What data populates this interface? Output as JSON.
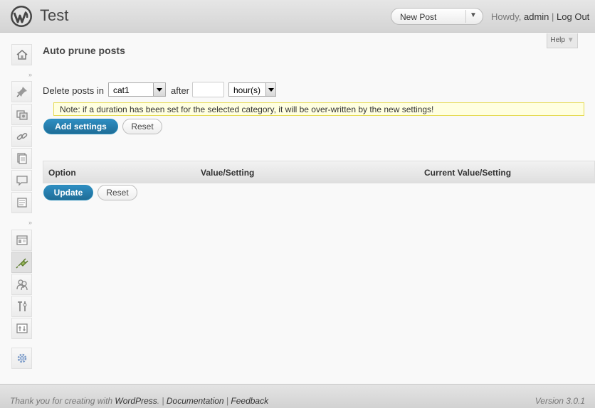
{
  "header": {
    "site_title": "Test",
    "favorite_action": "New Post",
    "howdy": "Howdy, ",
    "username": "admin",
    "separator": " | ",
    "logout": "Log Out"
  },
  "help_tab": {
    "label": "Help"
  },
  "page": {
    "title": "Auto prune posts",
    "delete_label": "Delete posts in",
    "category_value": "cat1",
    "after_label": "after",
    "duration_value": "",
    "unit_value": "hour(s)",
    "note": "Note: if a duration has been set for the selected category, it will be over-written by the new settings!",
    "add_button": "Add settings",
    "reset_button": "Reset",
    "update_button": "Update",
    "reset_button_2": "Reset"
  },
  "table": {
    "columns": [
      "Option",
      "Value/Setting",
      "Current Value/Setting"
    ]
  },
  "footer": {
    "thank_you": "Thank you for creating with ",
    "wordpress": "WordPress",
    "sep1": ". | ",
    "documentation": "Documentation",
    "sep2": " | ",
    "feedback": "Feedback",
    "version": "Version 3.0.1"
  },
  "menu_icons": [
    "dashboard-icon",
    "posts-icon",
    "media-icon",
    "links-icon",
    "pages-icon",
    "comments-icon",
    "text-icon",
    "appearance-icon",
    "plugins-icon",
    "users-icon",
    "tools-icon",
    "settings-icon",
    "custom-icon"
  ],
  "colors": {
    "primary_button": "#21759b",
    "link": "#21759b",
    "note_bg": "#ffffe0",
    "note_border": "#e6db55"
  }
}
